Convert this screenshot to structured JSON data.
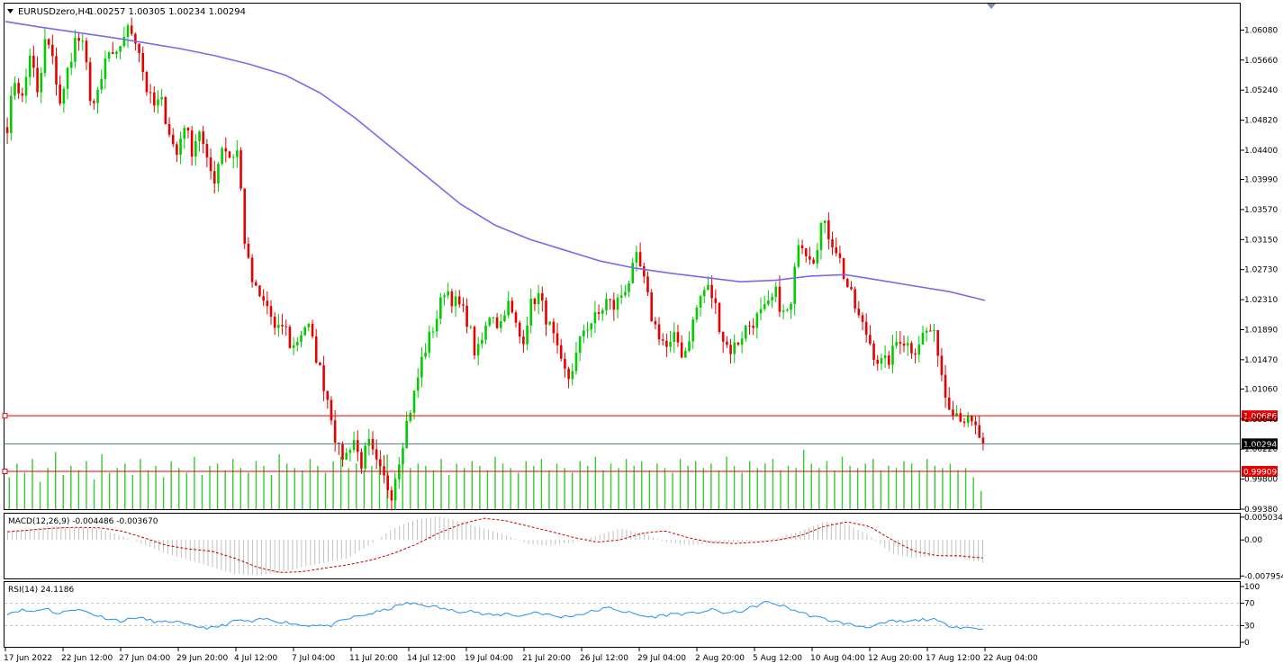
{
  "header": {
    "symbol_label": "EURUSDzero,H4",
    "ohlc_label": "1.00257 1.00305 1.00234 1.00294"
  },
  "panels": {
    "macd_label": "MACD(12,26,9) -0.004486 -0.003670",
    "rsi_label": "RSI(14) 24.1186"
  },
  "colors": {
    "bull": "#00cc00",
    "bear": "#e60000",
    "ma": "#7b68ee",
    "volume": "#32cd32",
    "level_line": "#e60000",
    "price_line": "#4f7f7f",
    "macd_hist": "#c0c0c0",
    "macd_signal": "#cc0000",
    "rsi_line": "#1e90ff",
    "axis": "#000000"
  },
  "chart_data": [
    {
      "type": "candlestick",
      "panel": "price",
      "ylim": [
        0.9938,
        1.0645
      ],
      "y_ticks": [
        "1.06080",
        "1.05660",
        "1.05240",
        "1.04820",
        "1.04400",
        "1.03990",
        "1.03570",
        "1.03150",
        "1.02730",
        "1.02310",
        "1.01890",
        "1.01470",
        "1.01060",
        "1.00640",
        "1.00220",
        "0.99800",
        "0.99380"
      ],
      "x_ticks": [
        "17 Jun 2022",
        "22 Jun 12:00",
        "27 Jun 04:00",
        "29 Jun 20:00",
        "4 Jul 12:00",
        "7 Jul 04:00",
        "11 Jul 20:00",
        "14 Jul 12:00",
        "19 Jul 04:00",
        "21 Jul 20:00",
        "26 Jul 12:00",
        "29 Jul 04:00",
        "2 Aug 20:00",
        "5 Aug 12:00",
        "10 Aug 04:00",
        "12 Aug 20:00",
        "17 Aug 12:00",
        "22 Aug 04:00"
      ],
      "candle_path": [
        1.0475,
        1.054,
        1.051,
        1.058,
        1.051,
        1.06,
        1.056,
        1.05,
        1.056,
        1.06,
        1.058,
        1.05,
        1.052,
        1.058,
        1.056,
        1.06,
        1.061,
        1.059,
        1.053,
        1.05,
        1.051,
        1.047,
        1.043,
        1.048,
        1.044,
        1.047,
        1.042,
        1.04,
        1.045,
        1.043,
        1.044,
        1.03,
        1.025,
        1.023,
        1.022,
        1.018,
        1.02,
        1.016,
        1.018,
        1.02,
        1.016,
        1.012,
        1.008,
        1.002,
        1.001,
        1.004,
        1.0,
        1.003,
        1.0,
        0.998,
        0.996,
        1.001,
        1.006,
        1.01,
        1.015,
        1.018,
        1.021,
        1.025,
        1.023,
        1.022,
        1.02,
        1.015,
        1.018,
        1.022,
        1.019,
        1.023,
        1.02,
        1.017,
        1.022,
        1.024,
        1.021,
        1.018,
        1.014,
        1.012,
        1.015,
        1.019,
        1.02,
        1.021,
        1.023,
        1.022,
        1.024,
        1.026,
        1.029,
        1.025,
        1.02,
        1.018,
        1.016,
        1.018,
        1.015,
        1.019,
        1.023,
        1.025,
        1.023,
        1.018,
        1.016,
        1.017,
        1.019,
        1.02,
        1.021,
        1.022,
        1.024,
        1.021,
        1.022,
        1.032,
        1.03,
        1.029,
        1.034,
        1.032,
        1.03,
        1.026,
        1.023,
        1.02,
        1.018,
        1.015,
        1.014,
        1.015,
        1.018,
        1.017,
        1.016,
        1.018,
        1.019,
        1.017,
        1.01,
        1.008,
        1.007,
        1.006,
        1.005,
        1.0029
      ],
      "last_price": 1.00294,
      "moving_average": [
        1.062,
        1.0612,
        1.0605,
        1.0598,
        1.059,
        1.0582,
        1.0572,
        1.056,
        1.0545,
        1.052,
        1.0485,
        1.0445,
        1.0405,
        1.0365,
        1.0335,
        1.0315,
        1.03,
        1.0285,
        1.0275,
        1.0268,
        1.0262,
        1.0256,
        1.0258,
        1.0264,
        1.0266,
        1.0258,
        1.025,
        1.0242,
        1.023
      ],
      "horizontal_lines": [
        {
          "value": 1.00686,
          "label": "1.00686",
          "color": "#e60000"
        },
        {
          "value": 1.00294,
          "label": "1.00294",
          "color": "#4f7f7f"
        },
        {
          "value": 0.99909,
          "label": "0.99909",
          "color": "#e60000"
        }
      ],
      "grid": false
    },
    {
      "type": "bar",
      "panel": "volume",
      "series": [
        {
          "values": [
            14,
            20,
            16,
            22,
            12,
            18,
            25,
            15,
            19,
            17,
            21,
            13,
            24,
            16,
            18,
            20,
            15,
            22,
            17,
            19,
            14,
            21,
            18,
            16,
            23,
            15,
            19,
            20,
            17,
            22,
            18,
            16,
            21,
            19,
            15,
            24,
            20,
            18,
            17,
            22,
            19,
            16,
            21,
            23,
            18,
            20,
            17,
            19,
            22,
            24,
            16,
            21,
            18,
            20,
            19,
            17,
            22,
            15,
            20,
            18,
            21,
            19,
            17,
            23,
            20,
            18,
            16,
            21,
            19,
            22,
            17,
            20,
            18,
            16,
            21,
            19,
            23,
            17,
            20,
            18,
            22,
            19,
            21,
            17,
            20,
            18,
            16,
            22,
            19,
            21,
            18,
            20,
            17,
            23,
            19,
            16,
            21,
            18,
            20,
            22,
            17,
            19,
            18,
            26,
            20,
            18,
            21,
            17,
            23,
            19,
            18,
            20,
            22,
            17,
            19,
            18,
            21,
            20,
            17,
            22,
            19,
            18,
            20,
            17,
            18,
            14,
            8
          ]
        }
      ]
    },
    {
      "type": "bar",
      "panel": "macd",
      "y_ticks": [
        "0.005034",
        "0.00",
        "-0.007954"
      ],
      "ylim": [
        -0.0085,
        0.0058
      ],
      "macd_path": [
        0.002,
        0.0025,
        0.003,
        0.0028,
        0.0025,
        0.001,
        -0.001,
        -0.003,
        -0.0045,
        -0.006,
        -0.0075,
        -0.0078,
        -0.0072,
        -0.006,
        -0.005,
        -0.004,
        -0.001,
        0.0025,
        0.0045,
        0.0052,
        0.004,
        0.0025,
        0.001,
        -0.001,
        -0.0012,
        -0.0005,
        0.001,
        0.0025,
        0.0015,
        -0.0005,
        -0.0012,
        -0.0008,
        -0.0005,
        -0.0002,
        0.0005,
        0.002,
        0.004,
        0.0035,
        0.001,
        -0.003,
        -0.004,
        -0.0035,
        -0.004,
        -0.005
      ],
      "signal_path": [
        0.0018,
        0.0022,
        0.0026,
        0.0028,
        0.0027,
        0.002,
        0.0005,
        -0.0012,
        -0.002,
        -0.0025,
        -0.004,
        -0.006,
        -0.0072,
        -0.007,
        -0.0062,
        -0.0055,
        -0.0045,
        -0.003,
        -0.001,
        0.0015,
        0.0035,
        0.0048,
        0.0042,
        0.003,
        0.0018,
        0.0005,
        -0.0005,
        0.0,
        0.0015,
        0.002,
        0.0005,
        -0.0005,
        -0.0008,
        -0.0005,
        0.0,
        0.001,
        0.003,
        0.004,
        0.003,
        0.0,
        -0.0025,
        -0.0035,
        -0.0035,
        -0.004
      ]
    },
    {
      "type": "line",
      "panel": "rsi",
      "y_ticks": [
        "100",
        "70",
        "30",
        "0"
      ],
      "levels": [
        70,
        30
      ],
      "ylim": [
        0,
        100
      ],
      "rsi_path": [
        52,
        58,
        55,
        62,
        50,
        60,
        56,
        48,
        42,
        38,
        45,
        40,
        35,
        38,
        30,
        28,
        25,
        32,
        40,
        36,
        42,
        38,
        35,
        30,
        32,
        28,
        38,
        45,
        50,
        55,
        62,
        70,
        68,
        65,
        60,
        55,
        58,
        50,
        48,
        52,
        46,
        55,
        50,
        45,
        48,
        52,
        58,
        62,
        55,
        50,
        45,
        48,
        52,
        50,
        55,
        58,
        52,
        55,
        62,
        72,
        68,
        60,
        52,
        45,
        40,
        35,
        30,
        28,
        32,
        38,
        36,
        40,
        42,
        32,
        28,
        26,
        24
      ]
    }
  ]
}
